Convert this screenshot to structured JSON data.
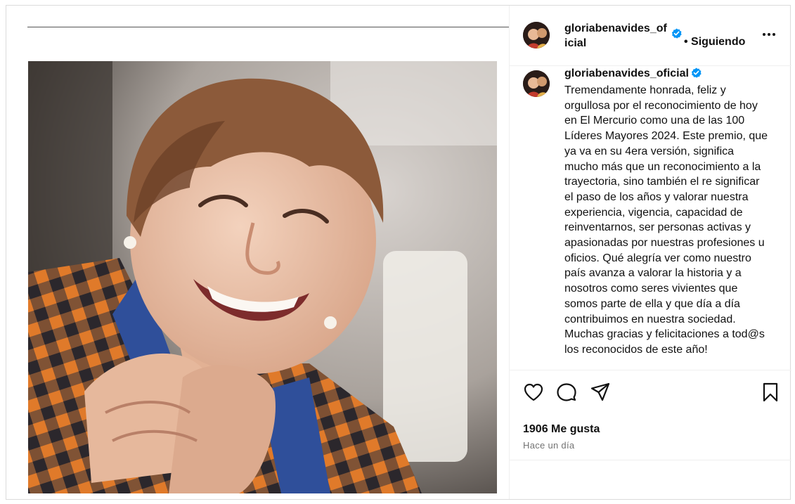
{
  "post": {
    "image_alt": "Mujer mayor sonriendo con camisa a cuadros naranja y azul",
    "header": {
      "username": "gloriabenavides_oficial",
      "verified": true,
      "follow_status": "• Siguiendo",
      "more_icon": "more-horizontal-icon"
    },
    "caption": {
      "username": "gloriabenavides_oficial",
      "text": "Tremendamente honrada, feliz y orgullosa por el reconocimiento de hoy en El Mercurio como una de las 100 Líderes Mayores 2024. Este premio, que ya va en su 4era versión, significa mucho más que un reconocimiento a la trayectoria, sino también el re significar el paso de los años y valorar nuestra experiencia, vigencia, capacidad de reinventarnos, ser personas activas y apasionadas por nuestras profesiones u oficios. Qué alegría ver como nuestro país avanza a valorar la historia y a nosotros como seres vivientes que somos parte de ella y que día a día contribuimos en nuestra sociedad. Muchas gracias y felicitaciones a tod@s los reconocidos de este año!"
    },
    "actions": {
      "icons": [
        "heart-icon",
        "comment-icon",
        "share-icon",
        "bookmark-icon"
      ]
    },
    "likes_text": "1906 Me gusta",
    "time_text": "Hace un día",
    "colors": {
      "verified": "#0095f6",
      "text": "#111111",
      "muted": "#737373",
      "divider": "#efefef"
    }
  }
}
